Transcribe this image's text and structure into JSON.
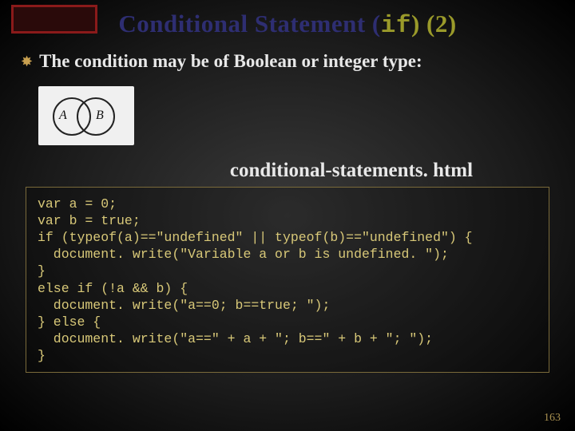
{
  "title": {
    "prefix": "Conditional Statement (",
    "keyword": "if",
    "suffix": ") (2)"
  },
  "bullet": {
    "icon": "✸",
    "text": "The condition may be of Boolean or integer type:"
  },
  "venn": {
    "a": "A",
    "b": "B"
  },
  "caption": "conditional-statements. html",
  "code": "var a = 0;\nvar b = true;\nif (typeof(a)==\"undefined\" || typeof(b)==\"undefined\") {\n  document. write(\"Variable a or b is undefined. \");\n}\nelse if (!a && b) {\n  document. write(\"a==0; b==true; \");\n} else {\n  document. write(\"a==\" + a + \"; b==\" + b + \"; \");\n}",
  "page_number": "163"
}
